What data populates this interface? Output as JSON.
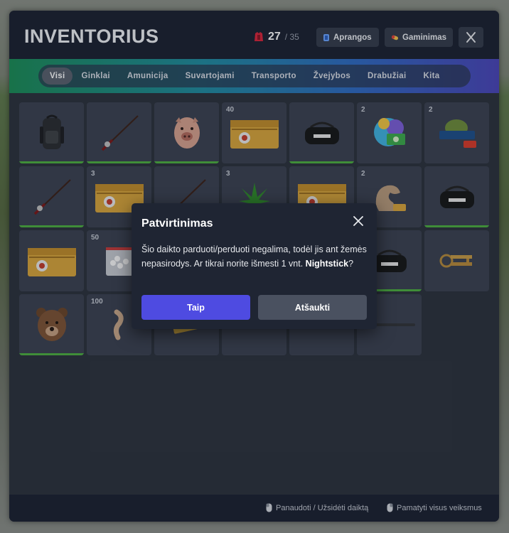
{
  "header": {
    "title": "INVENTORIUS",
    "capacity": {
      "current": "27",
      "max": "/ 35"
    },
    "buttons": [
      {
        "label": "Aprangos",
        "icon": "clothing-icon"
      },
      {
        "label": "Gaminimas",
        "icon": "crafting-icon"
      }
    ],
    "close_icon": "close-icon"
  },
  "tabs": [
    "Visi",
    "Ginklai",
    "Amunicija",
    "Suvartojami",
    "Transporto",
    "Žvejybos",
    "Drabužiai",
    "Kita"
  ],
  "active_tab": "Visi",
  "slots": [
    {
      "item": "backpack",
      "count": "",
      "durability": 1
    },
    {
      "item": "fishing-rod",
      "count": "",
      "durability": 1
    },
    {
      "item": "pig-mask",
      "count": "",
      "durability": 1
    },
    {
      "item": "weapon-case",
      "count": "40",
      "durability": 0
    },
    {
      "item": "adidas-bag",
      "count": "",
      "durability": 1
    },
    {
      "item": "money-pack",
      "count": "2",
      "durability": 0
    },
    {
      "item": "outfishing-xp",
      "count": "2",
      "durability": 0
    },
    {
      "item": "fishing-rod",
      "count": "",
      "durability": 1
    },
    {
      "item": "weapon-case",
      "count": "3",
      "durability": 0
    },
    {
      "item": "fishing-rod",
      "count": "",
      "durability": 0
    },
    {
      "item": "weed",
      "count": "3",
      "durability": 0
    },
    {
      "item": "weapon-case",
      "count": "",
      "durability": 0
    },
    {
      "item": "muscle-xp",
      "count": "2",
      "durability": 0
    },
    {
      "item": "adidas-bag",
      "count": "",
      "durability": 1
    },
    {
      "item": "weapon-case",
      "count": "",
      "durability": 0
    },
    {
      "item": "white-pills",
      "count": "50",
      "durability": 0
    },
    {
      "item": "hidden",
      "count": "",
      "durability": 0
    },
    {
      "item": "hidden",
      "count": "",
      "durability": 0
    },
    {
      "item": "hidden",
      "count": "",
      "durability": 0
    },
    {
      "item": "adidas-bag",
      "count": "",
      "durability": 1
    },
    {
      "item": "keys",
      "count": "",
      "durability": 0
    },
    {
      "item": "bear-mask",
      "count": "",
      "durability": 1
    },
    {
      "item": "fishing-bait",
      "count": "100",
      "durability": 0
    },
    {
      "item": "ticket",
      "count": "",
      "durability": 0
    },
    {
      "item": "hidden",
      "count": "",
      "durability": 0
    },
    {
      "item": "hidden",
      "count": "",
      "durability": 0
    },
    {
      "item": "nightstick",
      "count": "",
      "durability": 0
    }
  ],
  "footer": {
    "use_hint": "Panaudoti / Užsidėti daiktą",
    "actions_hint": "Pamatyti visus veiksmus"
  },
  "modal": {
    "title": "Patvirtinimas",
    "text_before": "Šio daikto parduoti/perduoti negalima, todėl jis ant žemės nepasirodys. Ar tikrai norite išmesti 1 vnt.",
    "item_name": "Nightstick",
    "text_after": "?",
    "confirm_label": "Taip",
    "cancel_label": "Atšaukti"
  },
  "colors": {
    "accent": "#4e4be1",
    "durability": "#4caf3f",
    "panel": "#2b313c",
    "header": "#1a2030"
  }
}
